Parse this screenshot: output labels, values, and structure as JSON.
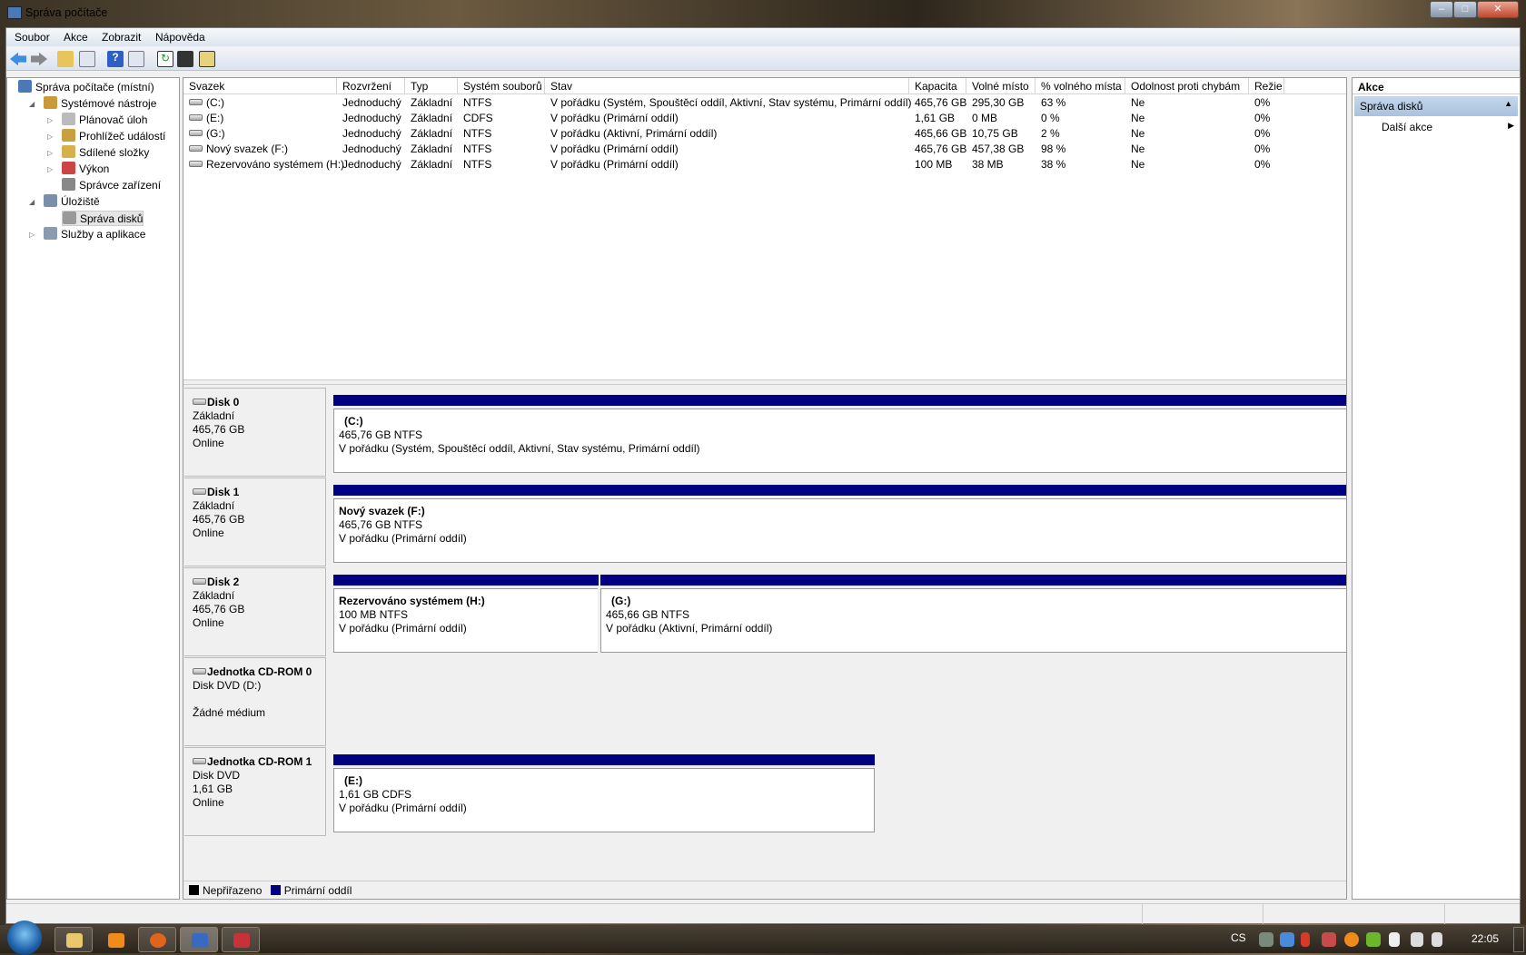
{
  "window": {
    "title": "Správa počítače",
    "min": "–",
    "max": "□",
    "close": "✕"
  },
  "menu": [
    "Soubor",
    "Akce",
    "Zobrazit",
    "Nápověda"
  ],
  "toolbar": [
    "back-icon",
    "forward-icon",
    "up-folder-icon",
    "show-hide-tree-icon",
    "help-icon",
    "show-hide-action-pane-icon",
    "refresh-icon",
    "properties-icon",
    "settings-icon"
  ],
  "tree": [
    {
      "label": "Správa počítače (místní)",
      "level": 0,
      "exp": ""
    },
    {
      "label": "Systémové nástroje",
      "level": 1,
      "exp": "◢"
    },
    {
      "label": "Plánovač úloh",
      "level": 2,
      "exp": "▷"
    },
    {
      "label": "Prohlížeč událostí",
      "level": 2,
      "exp": "▷"
    },
    {
      "label": "Sdílené složky",
      "level": 2,
      "exp": "▷"
    },
    {
      "label": "Výkon",
      "level": 2,
      "exp": "▷"
    },
    {
      "label": "Správce zařízení",
      "level": 2,
      "exp": ""
    },
    {
      "label": "Úložiště",
      "level": 1,
      "exp": "◢"
    },
    {
      "label": "Správa disků",
      "level": 2,
      "exp": "",
      "selected": true
    },
    {
      "label": "Služby a aplikace",
      "level": 1,
      "exp": "▷"
    }
  ],
  "table": {
    "headers": [
      "Svazek",
      "Rozvržení",
      "Typ",
      "Systém souborů",
      "Stav",
      "Kapacita",
      "Volné místo",
      "% volného místa",
      "Odolnost proti chybám",
      "Režie"
    ],
    "rows": [
      [
        "(C:)",
        "Jednoduchý",
        "Základní",
        "NTFS",
        "V pořádku (Systém, Spouštěcí oddíl, Aktivní, Stav systému, Primární oddíl)",
        "465,76 GB",
        "295,30 GB",
        "63 %",
        "Ne",
        "0%"
      ],
      [
        "(E:)",
        "Jednoduchý",
        "Základní",
        "CDFS",
        "V pořádku (Primární oddíl)",
        "1,61 GB",
        "0 MB",
        "0 %",
        "Ne",
        "0%"
      ],
      [
        "(G:)",
        "Jednoduchý",
        "Základní",
        "NTFS",
        "V pořádku (Aktivní, Primární oddíl)",
        "465,66 GB",
        "10,75 GB",
        "2 %",
        "Ne",
        "0%"
      ],
      [
        "Nový svazek (F:)",
        "Jednoduchý",
        "Základní",
        "NTFS",
        "V pořádku (Primární oddíl)",
        "465,76 GB",
        "457,38 GB",
        "98 %",
        "Ne",
        "0%"
      ],
      [
        "Rezervováno systémem (H:)",
        "Jednoduchý",
        "Základní",
        "NTFS",
        "V pořádku (Primární oddíl)",
        "100 MB",
        "38 MB",
        "38 %",
        "Ne",
        "0%"
      ]
    ]
  },
  "disks": [
    {
      "name": "Disk 0",
      "lines": [
        "Základní",
        "465,76 GB",
        "Online"
      ],
      "partitions": [
        {
          "title": "(C:)",
          "size": "465,76 GB NTFS",
          "status": "V pořádku (Systém, Spouštěcí oddíl, Aktivní, Stav systému, Primární oddíl)"
        }
      ]
    },
    {
      "name": "Disk 1",
      "lines": [
        "Základní",
        "465,76 GB",
        "Online"
      ],
      "partitions": [
        {
          "title": "Nový svazek  (F:)",
          "size": "465,76 GB NTFS",
          "status": "V pořádku (Primární oddíl)"
        }
      ]
    },
    {
      "name": "Disk 2",
      "lines": [
        "Základní",
        "465,76 GB",
        "Online"
      ],
      "partitions": [
        {
          "title": "Rezervováno systémem  (H:)",
          "size": "100 MB NTFS",
          "status": "V pořádku (Primární oddíl)"
        },
        {
          "title": "(G:)",
          "size": "465,66 GB NTFS",
          "status": "V pořádku (Aktivní, Primární oddíl)"
        }
      ]
    },
    {
      "name": "Jednotka CD-ROM 0",
      "lines": [
        "Disk DVD (D:)",
        "",
        "Žádné médium"
      ],
      "partitions": []
    },
    {
      "name": "Jednotka CD-ROM 1",
      "lines": [
        "Disk DVD",
        "1,61 GB",
        "Online"
      ],
      "partitions": [
        {
          "title": "(E:)",
          "size": "1,61 GB CDFS",
          "status": "V pořádku (Primární oddíl)"
        }
      ]
    }
  ],
  "legend": [
    {
      "label": "Nepřiřazeno",
      "color": "#000000"
    },
    {
      "label": "Primární oddíl",
      "color": "#000080"
    }
  ],
  "actions": {
    "header": "Akce",
    "section": "Správa disků",
    "item": "Další akce"
  },
  "tray": {
    "lang": "CS",
    "clock": "22:05"
  }
}
